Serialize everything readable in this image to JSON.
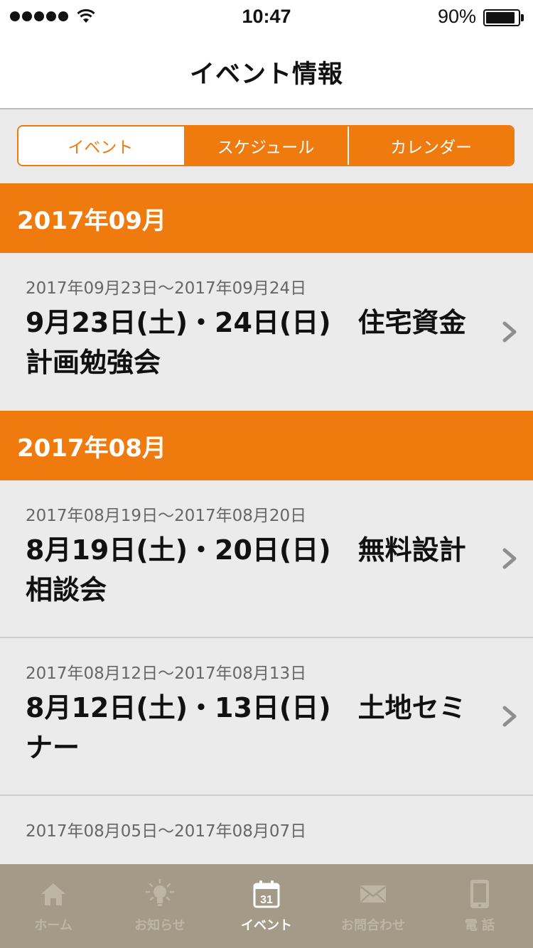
{
  "status_bar": {
    "time": "10:47",
    "battery": "90%",
    "battery_level": 0.9
  },
  "nav": {
    "title": "イベント情報"
  },
  "segments": [
    {
      "label": "イベント",
      "active": true
    },
    {
      "label": "スケジュール",
      "active": false
    },
    {
      "label": "カレンダー",
      "active": false
    }
  ],
  "sections": [
    {
      "month": "2017年09月",
      "events": [
        {
          "date_range": "2017年09月23日〜2017年09月24日",
          "title": "9月23日(土)・24日(日)　住宅資金計画勉強会"
        }
      ]
    },
    {
      "month": "2017年08月",
      "events": [
        {
          "date_range": "2017年08月19日〜2017年08月20日",
          "title": "8月19日(土)・20日(日)　無料設計相談会"
        },
        {
          "date_range": "2017年08月12日〜2017年08月13日",
          "title": "8月12日(土)・13日(日)　土地セミナー"
        },
        {
          "date_range": "2017年08月05日〜2017年08月07日",
          "title": ""
        }
      ]
    }
  ],
  "tabs": [
    {
      "label": "ホーム",
      "icon": "home-icon",
      "active": false
    },
    {
      "label": "お知らせ",
      "icon": "lightbulb-icon",
      "active": false
    },
    {
      "label": "イベント",
      "icon": "calendar-icon",
      "calendar_day": "31",
      "active": true
    },
    {
      "label": "お問合わせ",
      "icon": "mail-icon",
      "active": false
    },
    {
      "label": "電 話",
      "icon": "phone-icon",
      "active": false
    }
  ],
  "colors": {
    "accent": "#ef7a0e",
    "tab_bar": "#a39a87",
    "background": "#ebebeb"
  }
}
